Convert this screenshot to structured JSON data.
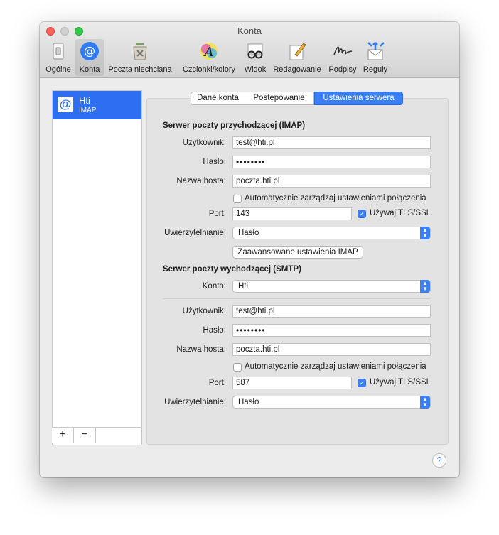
{
  "window": {
    "title": "Konta"
  },
  "toolbar": [
    {
      "label": "Ogólne",
      "icon": "switch-icon"
    },
    {
      "label": "Konta",
      "icon": "at-sign-icon",
      "selected": true
    },
    {
      "label": "Poczta niechciana",
      "icon": "junk-trash-icon"
    },
    {
      "label": "Czcionki/kolory",
      "icon": "font-color-icon"
    },
    {
      "label": "Widok",
      "icon": "glasses-icon"
    },
    {
      "label": "Redagowanie",
      "icon": "compose-pencil-icon"
    },
    {
      "label": "Podpisy",
      "icon": "signature-icon"
    },
    {
      "label": "Reguły",
      "icon": "rules-envelope-icon"
    }
  ],
  "sidebar": {
    "account": {
      "name": "Hti",
      "type": "IMAP",
      "icon": "at-sign-icon"
    },
    "add_label": "+",
    "remove_label": "−"
  },
  "tabs": [
    {
      "label": "Dane konta"
    },
    {
      "label": "Postępowanie"
    },
    {
      "label": "Ustawienia serwera",
      "active": true
    }
  ],
  "incoming": {
    "heading": "Serwer poczty przychodzącej (IMAP)",
    "user_label": "Użytkownik:",
    "user": "test@hti.pl",
    "password_label": "Hasło:",
    "password": "••••••••",
    "host_label": "Nazwa hosta:",
    "host": "poczta.hti.pl",
    "auto_manage": "Automatycznie zarządzaj ustawieniami połączenia",
    "auto_manage_checked": false,
    "port_label": "Port:",
    "port": "143",
    "tls_label": "Używaj TLS/SSL",
    "tls_checked": true,
    "auth_label": "Uwierzytelnianie:",
    "auth": "Hasło",
    "advanced_button": "Zaawansowane ustawienia IMAP"
  },
  "outgoing": {
    "heading": "Serwer poczty wychodzącej (SMTP)",
    "account_label": "Konto:",
    "account": "Hti",
    "user_label": "Użytkownik:",
    "user": "test@hti.pl",
    "password_label": "Hasło:",
    "password": "••••••••",
    "host_label": "Nazwa hosta:",
    "host": "poczta.hti.pl",
    "auto_manage": "Automatycznie zarządzaj ustawieniami połączenia",
    "auto_manage_checked": false,
    "port_label": "Port:",
    "port": "587",
    "tls_label": "Używaj TLS/SSL",
    "tls_checked": true,
    "auth_label": "Uwierzytelnianie:",
    "auth": "Hasło"
  },
  "help_label": "?",
  "colors": {
    "accent": "#3b7ff4",
    "selection": "#2d6ff0"
  }
}
